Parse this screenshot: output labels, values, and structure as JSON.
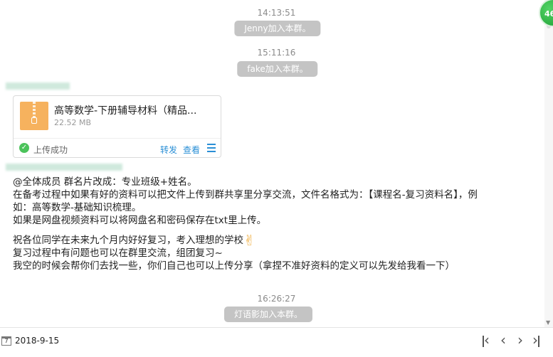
{
  "timeline": [
    {
      "time": "14:13:51",
      "notice": "Jenny加入本群。"
    },
    {
      "time": "15:11:16",
      "notice": "fake加入本群。"
    },
    {
      "time": "16:26:27",
      "notice": "灯语影加入本群。"
    }
  ],
  "file_message": {
    "file_name": "高等数学-下册辅导材料（精品...",
    "file_size": "22.52 MB",
    "status": "上传成功",
    "forward_label": "转发",
    "view_label": "查看"
  },
  "text_message": {
    "lines": [
      "@全体成员  群名片改成：专业班级+姓名。",
      "在备考过程中如果有好的资料可以把文件上传到群共享里分享交流，文件名格式为：【课程名-复习资料名】，例",
      "如：高等数学-基础知识梳理。",
      "如果是网盘视频资料可以将网盘名和密码保存在txt里上传。",
      "祝各位同学在未来九个月内好好复习，考入理想的学校",
      "复习过程中有问题也可以在群里交流，组团复习~",
      "我空的时候会帮你们去找一些，你们自己也可以上传分享（拿捏不准好资料的定义可以先发给我看一下）"
    ]
  },
  "bottom_bar": {
    "calendar_day": "7",
    "date": "2018-9-15"
  },
  "badge": {
    "count": "46"
  }
}
